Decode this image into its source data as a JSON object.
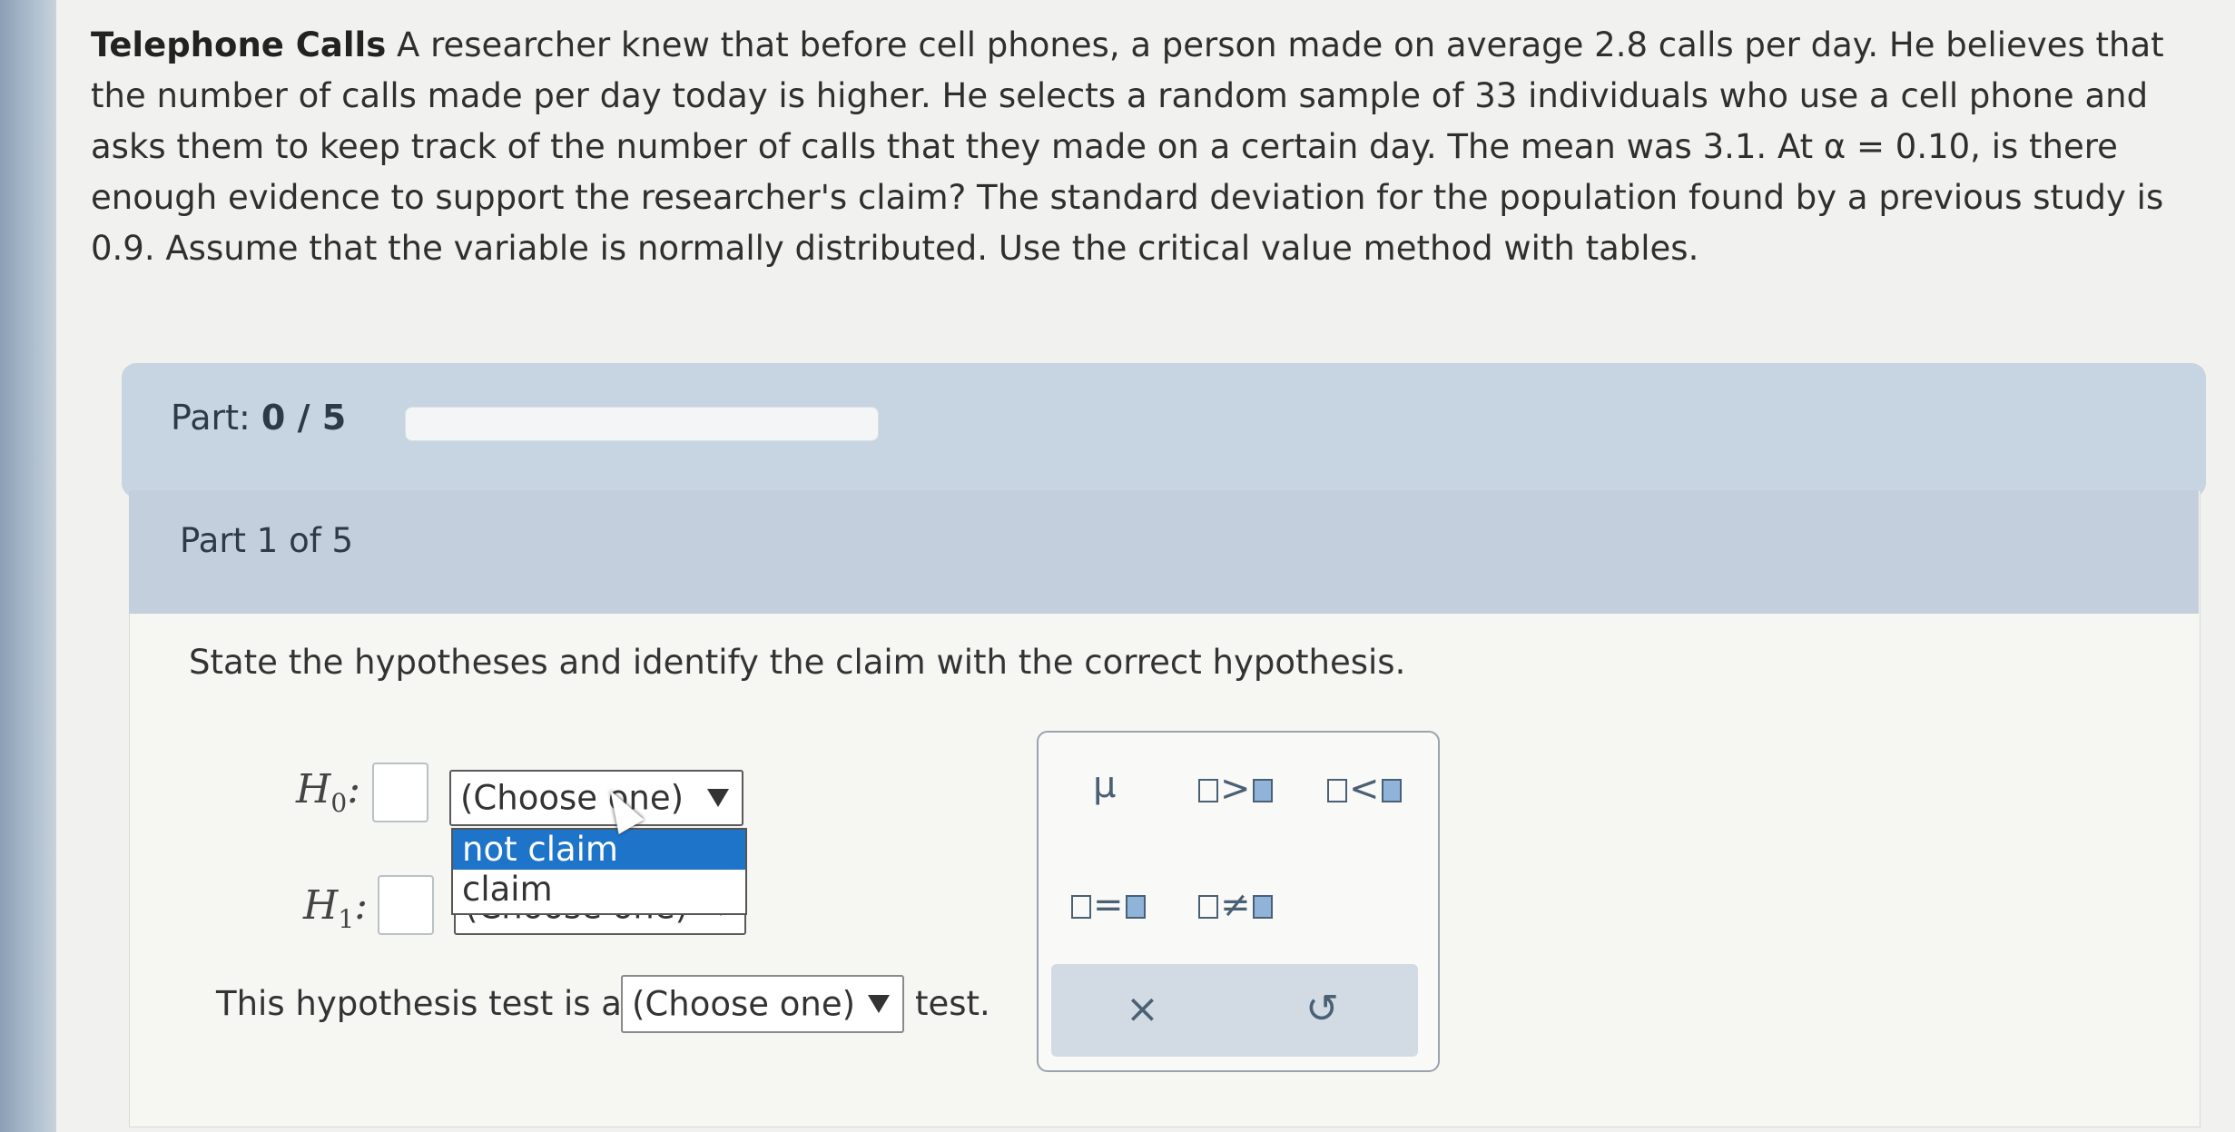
{
  "problem": {
    "title": "Telephone Calls",
    "text": "A researcher knew that before cell phones, a person made on average 2.8 calls per day. He believes that the number of calls made per day today is higher. He selects a random sample of 33 individuals who use a cell phone and asks them to keep track of the number of calls that they made on a certain day. The mean was 3.1. At α = 0.10, is there enough evidence to support the researcher's claim? The standard deviation for the population found by a previous study is 0.9. Assume that the variable is normally distributed. Use the critical value method with tables."
  },
  "progress": {
    "label": "Part:",
    "value": "0 / 5",
    "fraction": 0
  },
  "part": {
    "title": "Part 1 of 5",
    "instruction": "State the hypotheses and identify the claim with the correct hypothesis."
  },
  "hypotheses": {
    "h0_label": "H",
    "h0_sub": "0",
    "h1_label": "H",
    "h1_sub": "1",
    "h0_select": "(Choose one)",
    "h1_select": "(Choose one)",
    "dropdown_options": [
      "not claim",
      "claim"
    ]
  },
  "test_type": {
    "prefix": "This hypothesis test is a",
    "select": "(Choose one)",
    "suffix": "test."
  },
  "palette": {
    "mu": "μ",
    "greater": ">",
    "less": "<",
    "equal": "=",
    "not_equal": "≠",
    "clear": "×",
    "undo": "↺"
  }
}
